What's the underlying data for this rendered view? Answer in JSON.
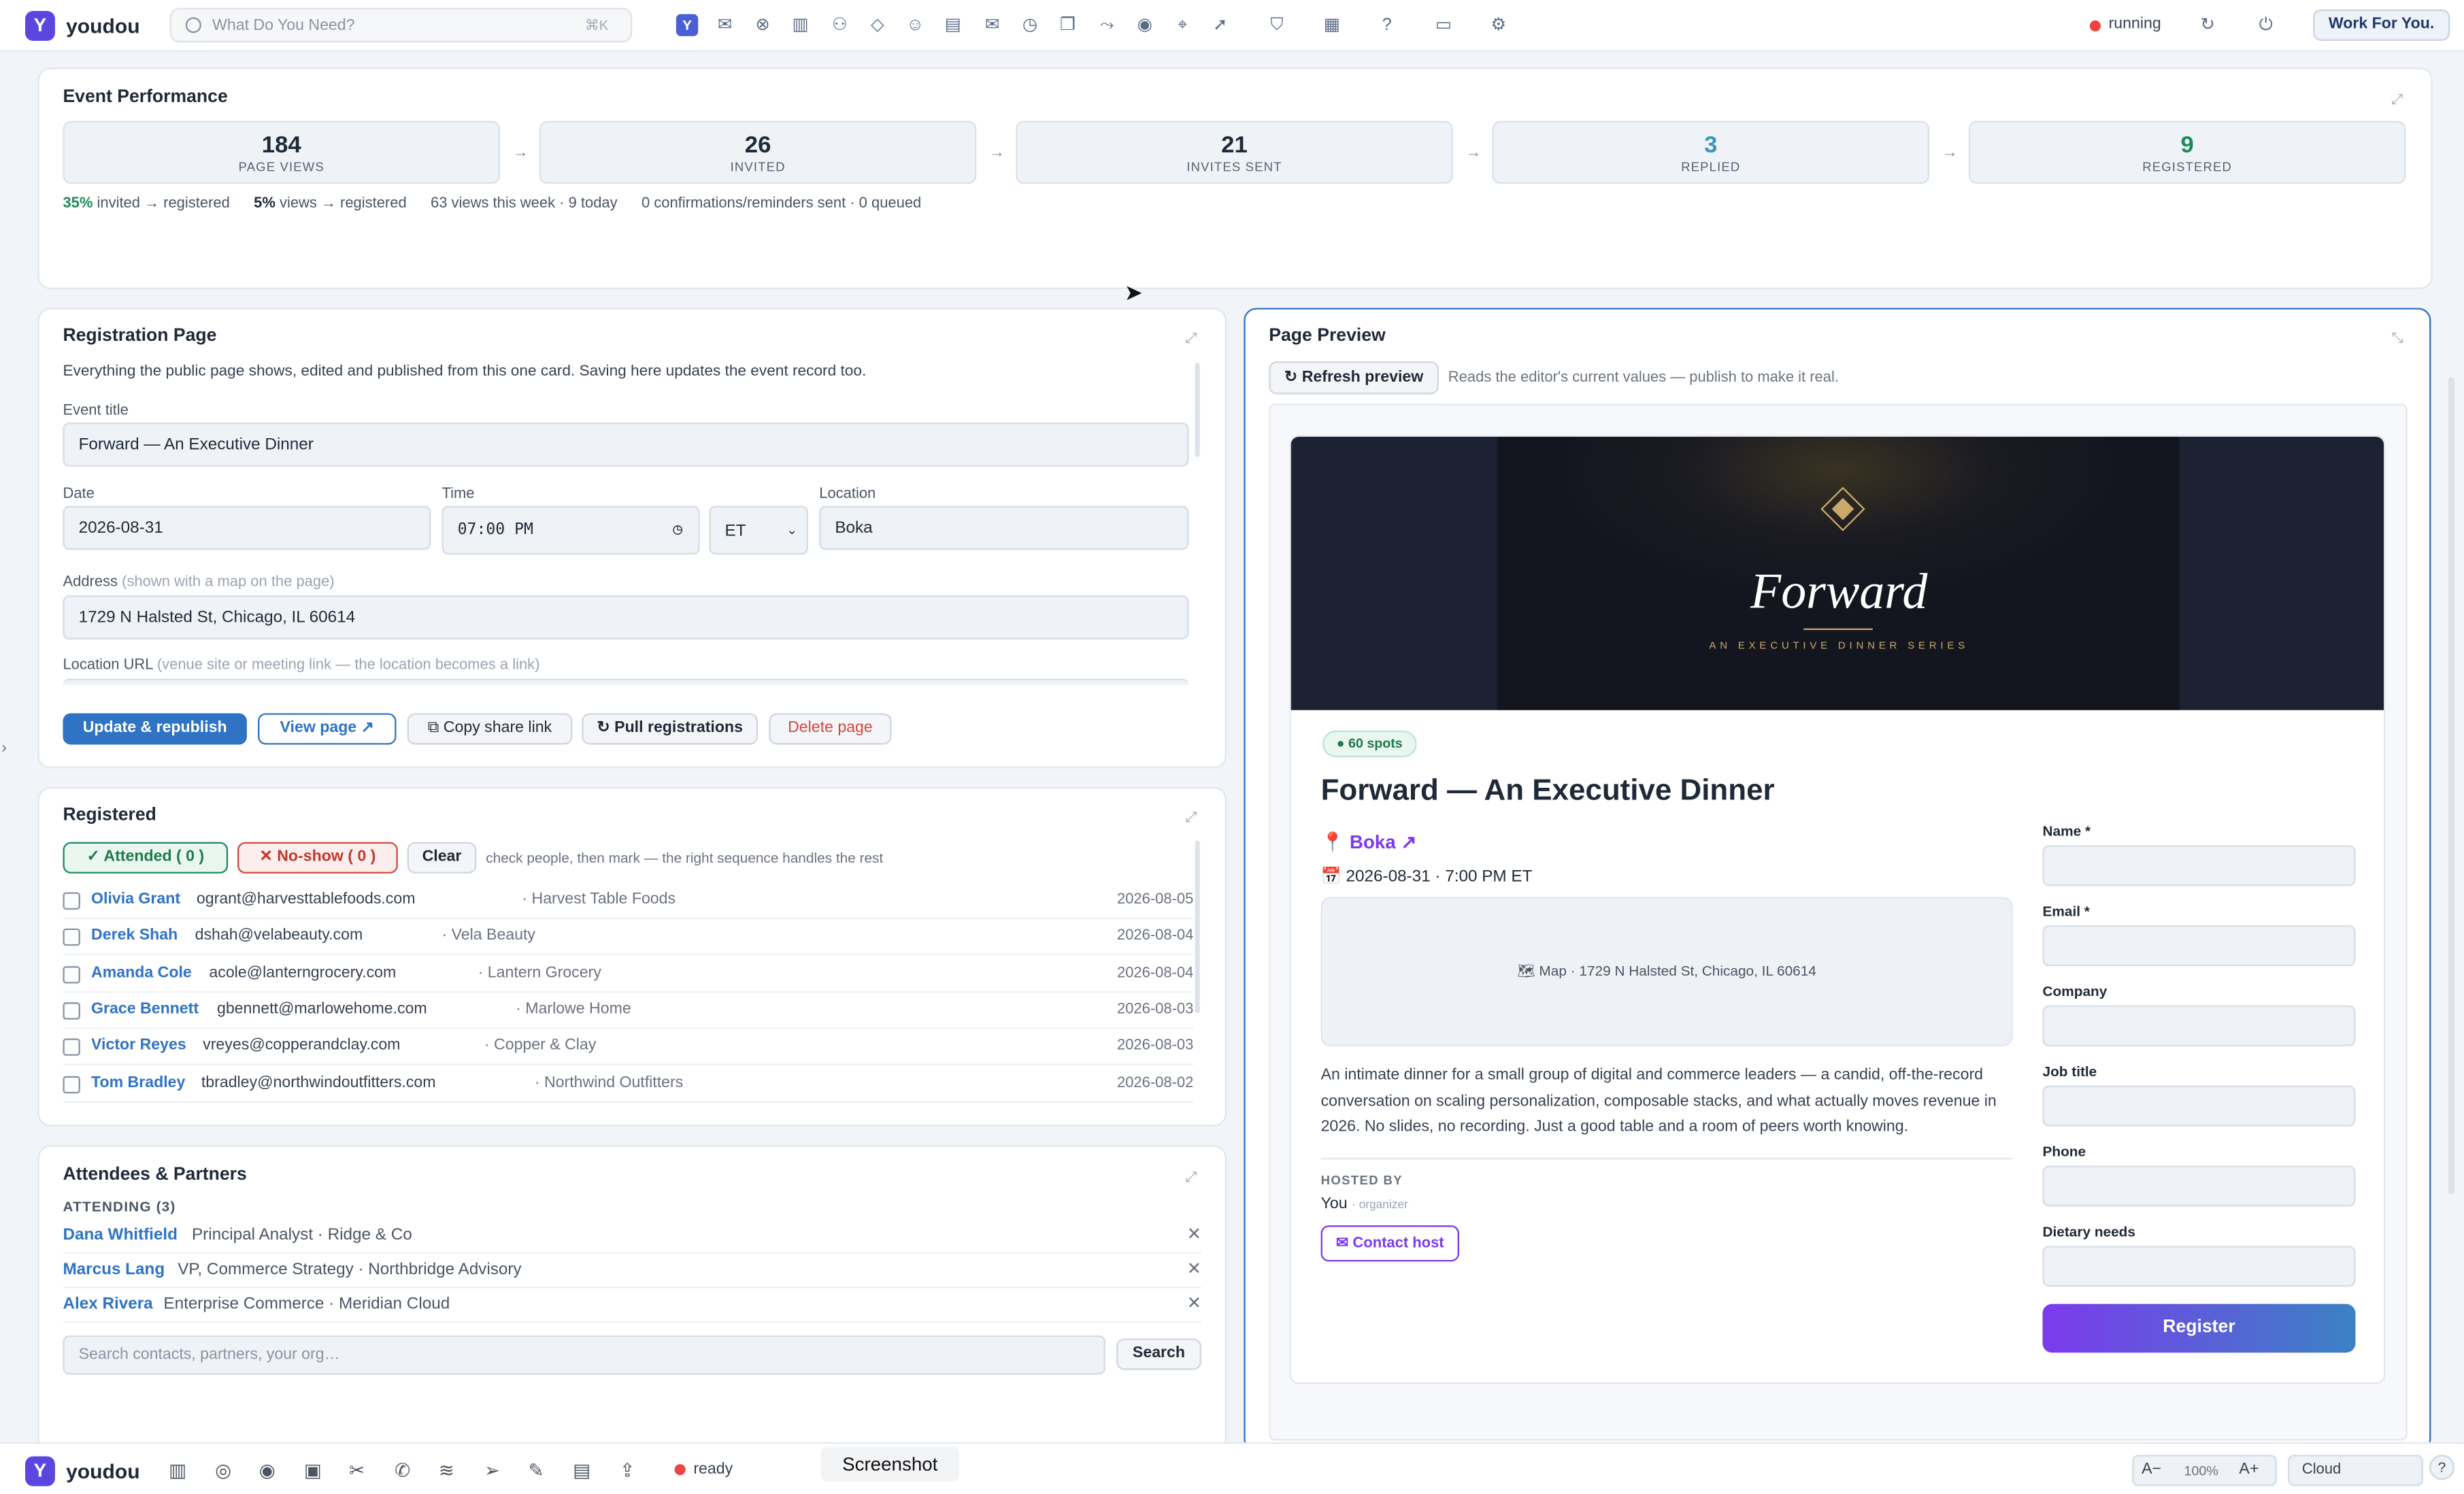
{
  "topbar": {
    "brand": "youdou",
    "logo_letter": "Y",
    "search_placeholder": "What Do You Need?",
    "search_shortcut": "⌘K",
    "status": "running",
    "work_button": "Work For You.",
    "icons": [
      "home-icon",
      "inbox-icon",
      "apps-icon",
      "building-icon",
      "people-icon",
      "gem-icon",
      "handshake-icon",
      "chart-icon",
      "mail-icon",
      "clock-icon",
      "copy-icon",
      "share-icon",
      "eye-icon",
      "megaphone-icon",
      "rocket-icon",
      "shield-icon",
      "clipboard-icon",
      "help-icon",
      "folder-icon",
      "gear-icon"
    ]
  },
  "performance": {
    "title": "Event Performance",
    "stats": [
      {
        "value": "184",
        "label": "PAGE VIEWS",
        "color": "#1f2937"
      },
      {
        "value": "26",
        "label": "INVITED",
        "color": "#1f2937"
      },
      {
        "value": "21",
        "label": "INVITES SENT",
        "color": "#1f2937"
      },
      {
        "value": "3",
        "label": "REPLIED",
        "color": "#3b97b8"
      },
      {
        "value": "9",
        "label": "REGISTERED",
        "color": "#1f8a5b"
      }
    ],
    "metric_invited_pct": "35%",
    "metric_invited_txt": "invited → registered",
    "metric_views_pct": "5%",
    "metric_views_txt": "views → registered",
    "metric_week": "63 views this week · 9 today",
    "metric_confirm": "0 confirmations/reminders sent · 0 queued"
  },
  "registration": {
    "title": "Registration Page",
    "subtitle": "Everything the public page shows, edited and published from this one card. Saving here updates the event record too.",
    "event_title_label": "Event title",
    "event_title_value": "Forward — An Executive Dinner",
    "date_label": "Date",
    "date_value": "2026-08-31",
    "time_label": "Time",
    "time_value": "07:00 PM",
    "timezone": "ET",
    "location_label": "Location",
    "location_value": "Boka",
    "address_label": "Address",
    "address_hint": "(shown with a map on the page)",
    "address_value": "1729 N Halsted St, Chicago, IL 60614",
    "url_label": "Location URL",
    "url_hint": "(venue site or meeting link — the location becomes a link)",
    "btn_update": "Update & republish",
    "btn_view": "View page ↗",
    "btn_copy": "⧉ Copy share link",
    "btn_pull": "↻ Pull registrations",
    "btn_delete": "Delete page"
  },
  "registered": {
    "title": "Registered",
    "attended": "✓ Attended ( 0 )",
    "noshow": "✕ No-show ( 0 )",
    "clear": "Clear",
    "hint": "check people, then mark — the right sequence handles the rest",
    "rows": [
      {
        "name": "Olivia Grant",
        "email": "ogrant@harvesttablefoods.com",
        "company": "· Harvest Table Foods",
        "date": "2026-08-05"
      },
      {
        "name": "Derek Shah",
        "email": "dshah@velabeauty.com",
        "company": "· Vela Beauty",
        "date": "2026-08-04"
      },
      {
        "name": "Amanda Cole",
        "email": "acole@lanterngrocery.com",
        "company": "· Lantern Grocery",
        "date": "2026-08-04"
      },
      {
        "name": "Grace Bennett",
        "email": "gbennett@marlowehome.com",
        "company": "· Marlowe Home",
        "date": "2026-08-03"
      },
      {
        "name": "Victor Reyes",
        "email": "vreyes@copperandclay.com",
        "company": "· Copper & Clay",
        "date": "2026-08-03"
      },
      {
        "name": "Tom Bradley",
        "email": "tbradley@northwindoutfitters.com",
        "company": "· Northwind Outfitters",
        "date": "2026-08-02"
      }
    ]
  },
  "attendees": {
    "title": "Attendees & Partners",
    "section": "ATTENDING (3)",
    "rows": [
      {
        "name": "Dana Whitfield",
        "desc": "Principal Analyst · Ridge & Co"
      },
      {
        "name": "Marcus Lang",
        "desc": "VP, Commerce Strategy · Northbridge Advisory"
      },
      {
        "name": "Alex Rivera",
        "desc": "Enterprise Commerce · Meridian Cloud"
      }
    ],
    "search_placeholder": "Search contacts, partners, your org…",
    "search_button": "Search",
    "remove_glyph": "✕"
  },
  "preview": {
    "title": "Page Preview",
    "refresh": "↻ Refresh preview",
    "hint": "Reads the editor's current values — publish to make it real.",
    "hero_title": "Forward",
    "hero_sub": "AN EXECUTIVE DINNER SERIES",
    "spots": "● 60 spots",
    "event_title": "Forward — An Executive Dinner",
    "location": "📍 Boka ↗",
    "datetime": "📅 2026-08-31 · 7:00 PM ET",
    "map": "🗺 Map · 1729 N Halsted St, Chicago, IL 60614",
    "description": "An intimate dinner for a small group of digital and commerce leaders — a candid, off-the-record conversation on scaling personalization, composable stacks, and what actually moves revenue in 2026. No slides, no recording. Just a good table and a room of peers worth knowing.",
    "hosted_by": "HOSTED BY",
    "host_name": "You",
    "host_role": "· organizer",
    "contact": "✉ Contact host",
    "form_fields": [
      "Name *",
      "Email *",
      "Company",
      "Job title",
      "Phone",
      "Dietary needs"
    ],
    "register": "Register"
  },
  "bottombar": {
    "brand": "youdou",
    "status": "ready",
    "screenshot_label": "Screenshot",
    "zoom_out": "A−",
    "zoom": "100%",
    "zoom_in": "A+",
    "cloud": "Cloud",
    "help": "?"
  },
  "colors": {
    "accent": "#2f73c4",
    "brand": "#5b47e0",
    "purple": "#7c3aed",
    "running": "#ef4444"
  }
}
